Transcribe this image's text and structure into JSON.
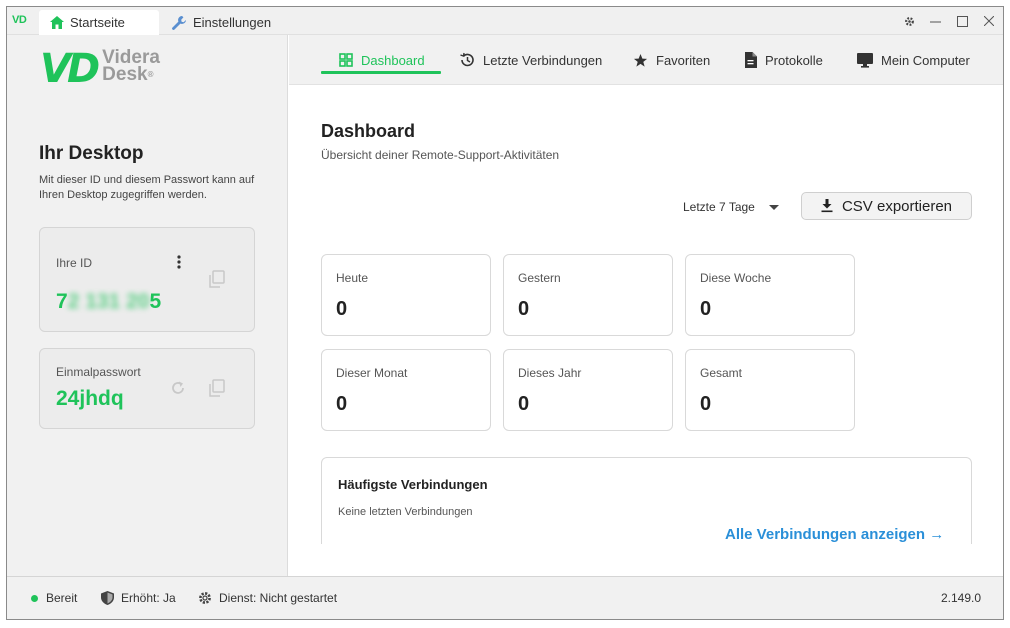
{
  "titlebar": {
    "app_badge": "VD",
    "tabs": [
      {
        "label": "Startseite",
        "icon": "home-icon",
        "active": true
      },
      {
        "label": "Einstellungen",
        "icon": "wrench-icon",
        "active": false
      }
    ]
  },
  "sidebar": {
    "logo_mark": "VD",
    "logo_word1": "Videra",
    "logo_word2": "Desk",
    "logo_reg": "®",
    "title": "Ihr Desktop",
    "description": "Mit dieser ID und diesem Passwort kann auf Ihren Desktop zugegriffen werden.",
    "id_card": {
      "label": "Ihre ID",
      "value_prefix": "7",
      "value_hidden": "2 131 20",
      "value_suffix": "5"
    },
    "pw_card": {
      "label": "Einmalpasswort",
      "value": "24jhdq"
    }
  },
  "nav": {
    "items": [
      {
        "label": "Dashboard",
        "icon": "grid-icon",
        "active": true
      },
      {
        "label": "Letzte Verbindungen",
        "icon": "history-icon"
      },
      {
        "label": "Favoriten",
        "icon": "star-icon"
      },
      {
        "label": "Protokolle",
        "icon": "document-icon"
      },
      {
        "label": "Mein Computer",
        "icon": "monitor-icon"
      }
    ]
  },
  "main": {
    "title": "Dashboard",
    "subtitle": "Übersicht deiner Remote-Support-Aktivitäten",
    "range_selected": "Letzte 7 Tage",
    "csv_label": "CSV exportieren",
    "stats": [
      {
        "label": "Heute",
        "value": "0"
      },
      {
        "label": "Gestern",
        "value": "0"
      },
      {
        "label": "Diese Woche",
        "value": "0"
      },
      {
        "label": "Dieser Monat",
        "value": "0"
      },
      {
        "label": "Dieses Jahr",
        "value": "0"
      },
      {
        "label": "Gesamt",
        "value": "0"
      }
    ],
    "frequent": {
      "title": "Häufigste Verbindungen",
      "empty": "Keine letzten Verbindungen",
      "link": "Alle Verbindungen anzeigen →"
    }
  },
  "status": {
    "ready": "Bereit",
    "elevated": "Erhöht: Ja",
    "service": "Dienst: Nicht gestartet",
    "version": "2.149.0"
  },
  "colors": {
    "accent": "#1fc35a",
    "link": "#2a8fd8"
  }
}
